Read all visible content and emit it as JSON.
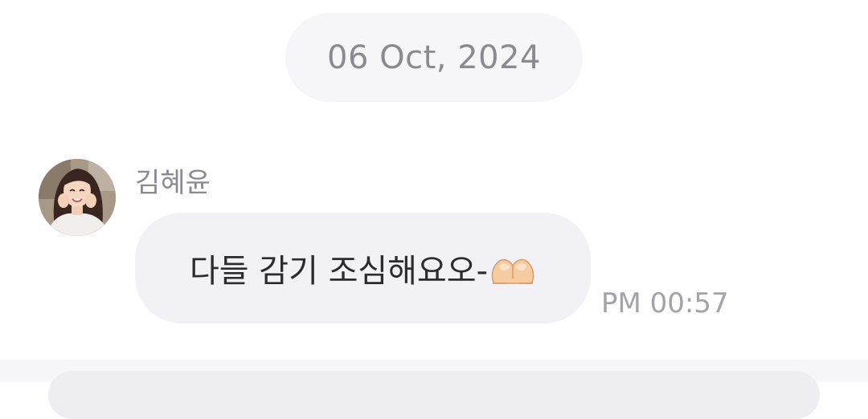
{
  "date_separator": {
    "label": "06 Oct, 2024"
  },
  "message": {
    "sender_name": "김혜윤",
    "avatar_icon": "profile-photo-avatar",
    "text": "다들 감기 조심해요오-",
    "emoji": "heart-hands-emoji",
    "timestamp": "PM 00:57"
  },
  "colors": {
    "background": "#ffffff",
    "date_pill_bg": "#f6f6f8",
    "bubble_bg": "#f2f2f6",
    "muted_text": "#8a8a90",
    "body_text": "#2c2c30",
    "timestamp_text": "#a3a3a8"
  }
}
